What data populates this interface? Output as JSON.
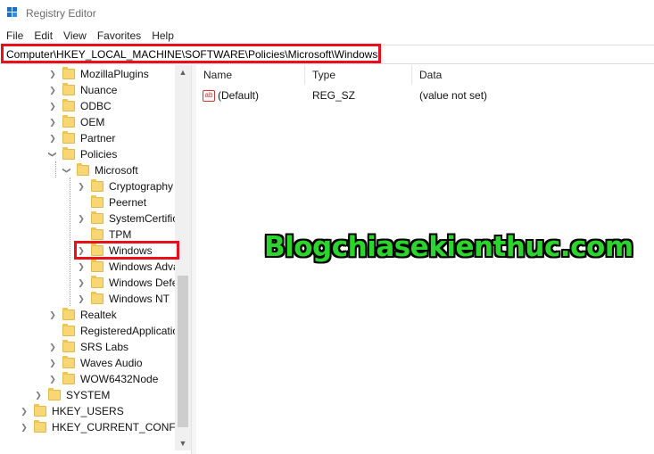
{
  "window": {
    "title": "Registry Editor",
    "icon": "registry-editor-icon"
  },
  "menu": [
    "File",
    "Edit",
    "View",
    "Favorites",
    "Help"
  ],
  "address": {
    "path": "Computer\\HKEY_LOCAL_MACHINE\\SOFTWARE\\Policies\\Microsoft\\Windows"
  },
  "tree": [
    {
      "label": "MozillaPlugins",
      "expander": "collapsed"
    },
    {
      "label": "Nuance",
      "expander": "collapsed"
    },
    {
      "label": "ODBC",
      "expander": "collapsed"
    },
    {
      "label": "OEM",
      "expander": "collapsed"
    },
    {
      "label": "Partner",
      "expander": "collapsed"
    },
    {
      "label": "Policies",
      "expander": "expanded"
    },
    {
      "label": "Microsoft",
      "expander": "expanded"
    },
    {
      "label": "Cryptography",
      "expander": "collapsed"
    },
    {
      "label": "Peernet",
      "expander": "none"
    },
    {
      "label": "SystemCertific",
      "expander": "collapsed"
    },
    {
      "label": "TPM",
      "expander": "none"
    },
    {
      "label": "Windows",
      "expander": "collapsed",
      "selected": true
    },
    {
      "label": "Windows Adva",
      "expander": "collapsed"
    },
    {
      "label": "Windows Defe",
      "expander": "collapsed"
    },
    {
      "label": "Windows NT",
      "expander": "collapsed"
    },
    {
      "label": "Realtek",
      "expander": "collapsed"
    },
    {
      "label": "RegisteredApplicatio",
      "expander": "none"
    },
    {
      "label": "SRS Labs",
      "expander": "collapsed"
    },
    {
      "label": "Waves Audio",
      "expander": "collapsed"
    },
    {
      "label": "WOW6432Node",
      "expander": "collapsed"
    },
    {
      "label": "SYSTEM",
      "expander": "collapsed"
    },
    {
      "label": "HKEY_USERS",
      "expander": "collapsed"
    },
    {
      "label": "HKEY_CURRENT_CONFIG",
      "expander": "collapsed"
    }
  ],
  "list": {
    "columns": [
      "Name",
      "Type",
      "Data"
    ],
    "rows": [
      {
        "name": "(Default)",
        "type": "REG_SZ",
        "data": "(value not set)",
        "icon": "string-value-icon"
      }
    ]
  },
  "watermark": "Blogchiasekienthuc.com",
  "colors": {
    "highlight": "#e8101b",
    "folder": "#f7d774",
    "watermark": "#2bd52b"
  }
}
